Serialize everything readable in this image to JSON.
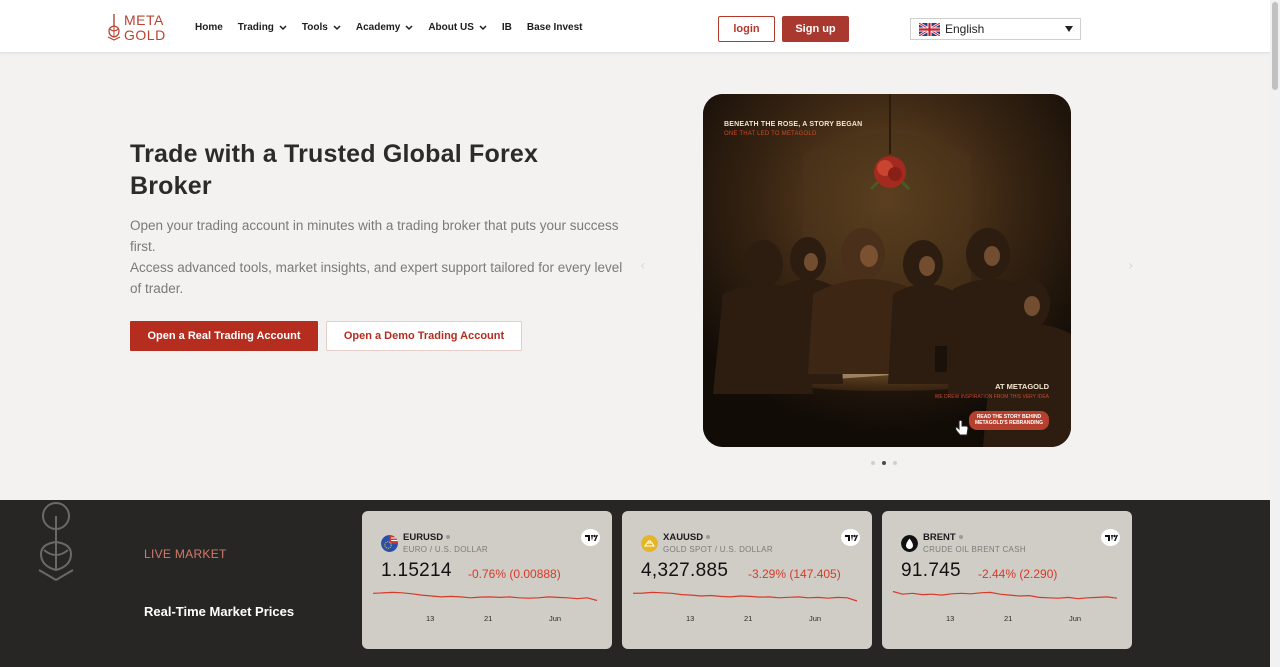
{
  "brand": {
    "logo_line1": "META",
    "logo_line2": "GOLD",
    "accent": "#b52d1f"
  },
  "nav": {
    "home": "Home",
    "trading": "Trading",
    "tools": "Tools",
    "academy": "Academy",
    "about": "About US",
    "ib": "IB",
    "base_invest": "Base Invest"
  },
  "auth": {
    "login": "login",
    "signup": "Sign up"
  },
  "language": {
    "selected": "English",
    "flag_icon": "uk-flag-icon"
  },
  "hero": {
    "title": "Trade with a Trusted Global Forex Broker",
    "desc_line1": "Open your trading account in minutes with a trading broker that puts your success first.",
    "desc_line2": "Access advanced tools, market insights, and expert support tailored for every level of trader.",
    "cta_real": "Open a Real Trading Account",
    "cta_demo": "Open a Demo Trading Account"
  },
  "banner": {
    "headline": "BENEATH THE ROSE, A STORY BEGAN",
    "subline": "ONE THAT LED TO METAGOLD",
    "tag": "AT METAGOLD",
    "tag_sub": "WE DREW INSPIRATION FROM THIS VERY IDEA",
    "cta_line1": "READ THE STORY BEHIND",
    "cta_line2": "METAGOLD'S REBRANDING"
  },
  "slider": {
    "active_index": 1,
    "count": 3
  },
  "market": {
    "kicker": "LIVE MARKET",
    "title": "Real-Time Market Prices",
    "ticks": [
      "13",
      "21",
      "Jun"
    ],
    "cards": [
      {
        "symbol": "EURUSD",
        "subtitle": "EURO / U.S. DOLLAR",
        "price": "1.15214",
        "change": "-0.76% (0.00888)",
        "icon": "eu-us-flag-icon",
        "series": [
          0.35,
          0.33,
          0.3,
          0.32,
          0.38,
          0.45,
          0.5,
          0.55,
          0.52,
          0.55,
          0.6,
          0.56,
          0.55,
          0.58,
          0.55,
          0.6,
          0.62,
          0.6,
          0.55,
          0.58,
          0.6,
          0.65,
          0.6,
          0.75
        ]
      },
      {
        "symbol": "XAUUSD",
        "subtitle": "GOLD SPOT / U.S. DOLLAR",
        "price": "4,327.885",
        "change": "-3.29% (147.405)",
        "icon": "gold-icon",
        "series": [
          0.35,
          0.34,
          0.3,
          0.32,
          0.35,
          0.42,
          0.45,
          0.5,
          0.47,
          0.52,
          0.55,
          0.5,
          0.52,
          0.56,
          0.55,
          0.6,
          0.57,
          0.55,
          0.6,
          0.58,
          0.62,
          0.58,
          0.6,
          0.78
        ]
      },
      {
        "symbol": "BRENT",
        "subtitle": "CRUDE OIL BRENT CASH",
        "price": "91.745",
        "change": "-2.44% (2.290)",
        "icon": "oil-drop-icon",
        "series": [
          0.25,
          0.4,
          0.35,
          0.42,
          0.4,
          0.45,
          0.38,
          0.35,
          0.38,
          0.32,
          0.3,
          0.4,
          0.45,
          0.5,
          0.48,
          0.58,
          0.6,
          0.62,
          0.58,
          0.65,
          0.6,
          0.58,
          0.55,
          0.62
        ]
      }
    ]
  }
}
